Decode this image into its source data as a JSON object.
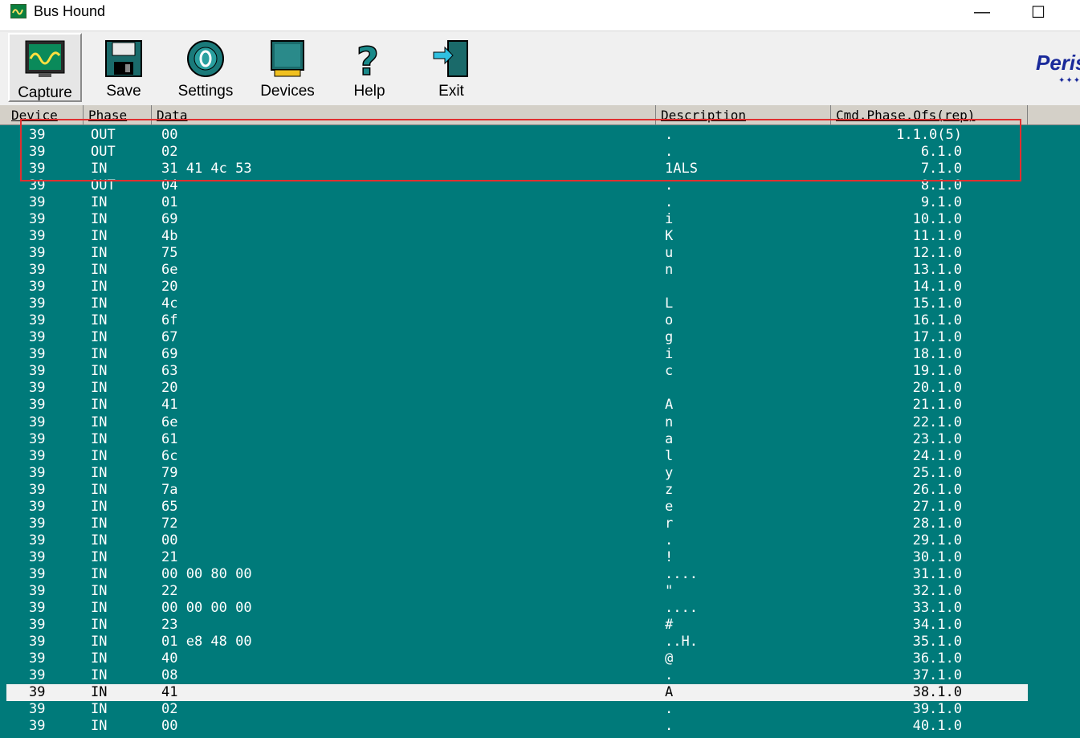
{
  "window": {
    "title": "Bus Hound",
    "minimize_glyph": "—",
    "maximize_glyph": "☐"
  },
  "toolbar": {
    "buttons": [
      {
        "label": "Capture",
        "icon": "capture-icon"
      },
      {
        "label": "Save",
        "icon": "floppy-icon"
      },
      {
        "label": "Settings",
        "icon": "gear-icon"
      },
      {
        "label": "Devices",
        "icon": "chip-icon"
      },
      {
        "label": "Help",
        "icon": "question-icon"
      },
      {
        "label": "Exit",
        "icon": "exit-door-icon"
      }
    ],
    "logo_text": "Peris",
    "logo_stars": "✦✦✦"
  },
  "columns": {
    "device": "Device",
    "phase": "Phase",
    "data": "Data",
    "description": "Description",
    "cmd": "Cmd.Phase.Ofs(rep)"
  },
  "rows": [
    {
      "device": "39",
      "phase": "OUT",
      "data": "00",
      "desc": ".",
      "cmd": "1.1.0(5)"
    },
    {
      "device": "39",
      "phase": "OUT",
      "data": "02",
      "desc": ".",
      "cmd": "6.1.0"
    },
    {
      "device": "39",
      "phase": "IN",
      "data": "31 41 4c 53",
      "desc": "1ALS",
      "cmd": "7.1.0"
    },
    {
      "device": "39",
      "phase": "OUT",
      "data": "04",
      "desc": ".",
      "cmd": "8.1.0"
    },
    {
      "device": "39",
      "phase": "IN",
      "data": "01",
      "desc": ".",
      "cmd": "9.1.0"
    },
    {
      "device": "39",
      "phase": "IN",
      "data": "69",
      "desc": "i",
      "cmd": "10.1.0"
    },
    {
      "device": "39",
      "phase": "IN",
      "data": "4b",
      "desc": "K",
      "cmd": "11.1.0"
    },
    {
      "device": "39",
      "phase": "IN",
      "data": "75",
      "desc": "u",
      "cmd": "12.1.0"
    },
    {
      "device": "39",
      "phase": "IN",
      "data": "6e",
      "desc": "n",
      "cmd": "13.1.0"
    },
    {
      "device": "39",
      "phase": "IN",
      "data": "20",
      "desc": "",
      "cmd": "14.1.0"
    },
    {
      "device": "39",
      "phase": "IN",
      "data": "4c",
      "desc": "L",
      "cmd": "15.1.0"
    },
    {
      "device": "39",
      "phase": "IN",
      "data": "6f",
      "desc": "o",
      "cmd": "16.1.0"
    },
    {
      "device": "39",
      "phase": "IN",
      "data": "67",
      "desc": "g",
      "cmd": "17.1.0"
    },
    {
      "device": "39",
      "phase": "IN",
      "data": "69",
      "desc": "i",
      "cmd": "18.1.0"
    },
    {
      "device": "39",
      "phase": "IN",
      "data": "63",
      "desc": "c",
      "cmd": "19.1.0"
    },
    {
      "device": "39",
      "phase": "IN",
      "data": "20",
      "desc": "",
      "cmd": "20.1.0"
    },
    {
      "device": "39",
      "phase": "IN",
      "data": "41",
      "desc": "A",
      "cmd": "21.1.0"
    },
    {
      "device": "39",
      "phase": "IN",
      "data": "6e",
      "desc": "n",
      "cmd": "22.1.0"
    },
    {
      "device": "39",
      "phase": "IN",
      "data": "61",
      "desc": "a",
      "cmd": "23.1.0"
    },
    {
      "device": "39",
      "phase": "IN",
      "data": "6c",
      "desc": "l",
      "cmd": "24.1.0"
    },
    {
      "device": "39",
      "phase": "IN",
      "data": "79",
      "desc": "y",
      "cmd": "25.1.0"
    },
    {
      "device": "39",
      "phase": "IN",
      "data": "7a",
      "desc": "z",
      "cmd": "26.1.0"
    },
    {
      "device": "39",
      "phase": "IN",
      "data": "65",
      "desc": "e",
      "cmd": "27.1.0"
    },
    {
      "device": "39",
      "phase": "IN",
      "data": "72",
      "desc": "r",
      "cmd": "28.1.0"
    },
    {
      "device": "39",
      "phase": "IN",
      "data": "00",
      "desc": ".",
      "cmd": "29.1.0"
    },
    {
      "device": "39",
      "phase": "IN",
      "data": "21",
      "desc": "!",
      "cmd": "30.1.0"
    },
    {
      "device": "39",
      "phase": "IN",
      "data": "00 00 80 00",
      "desc": "....",
      "cmd": "31.1.0"
    },
    {
      "device": "39",
      "phase": "IN",
      "data": "22",
      "desc": "\"",
      "cmd": "32.1.0"
    },
    {
      "device": "39",
      "phase": "IN",
      "data": "00 00 00 00",
      "desc": "....",
      "cmd": "33.1.0"
    },
    {
      "device": "39",
      "phase": "IN",
      "data": "23",
      "desc": "#",
      "cmd": "34.1.0"
    },
    {
      "device": "39",
      "phase": "IN",
      "data": "01 e8 48 00",
      "desc": "..H.",
      "cmd": "35.1.0"
    },
    {
      "device": "39",
      "phase": "IN",
      "data": "40",
      "desc": "@",
      "cmd": "36.1.0"
    },
    {
      "device": "39",
      "phase": "IN",
      "data": "08",
      "desc": ".",
      "cmd": "37.1.0"
    },
    {
      "device": "39",
      "phase": "IN",
      "data": "41",
      "desc": "A",
      "cmd": "38.1.0",
      "selected": true
    },
    {
      "device": "39",
      "phase": "IN",
      "data": "02",
      "desc": ".",
      "cmd": "39.1.0"
    },
    {
      "device": "39",
      "phase": "IN",
      "data": "00",
      "desc": ".",
      "cmd": "40.1.0"
    }
  ],
  "colors": {
    "data_background": "#007a7a",
    "row_text": "#ffffff",
    "selection": "#f2f2f2",
    "annotation": "#e03030"
  }
}
